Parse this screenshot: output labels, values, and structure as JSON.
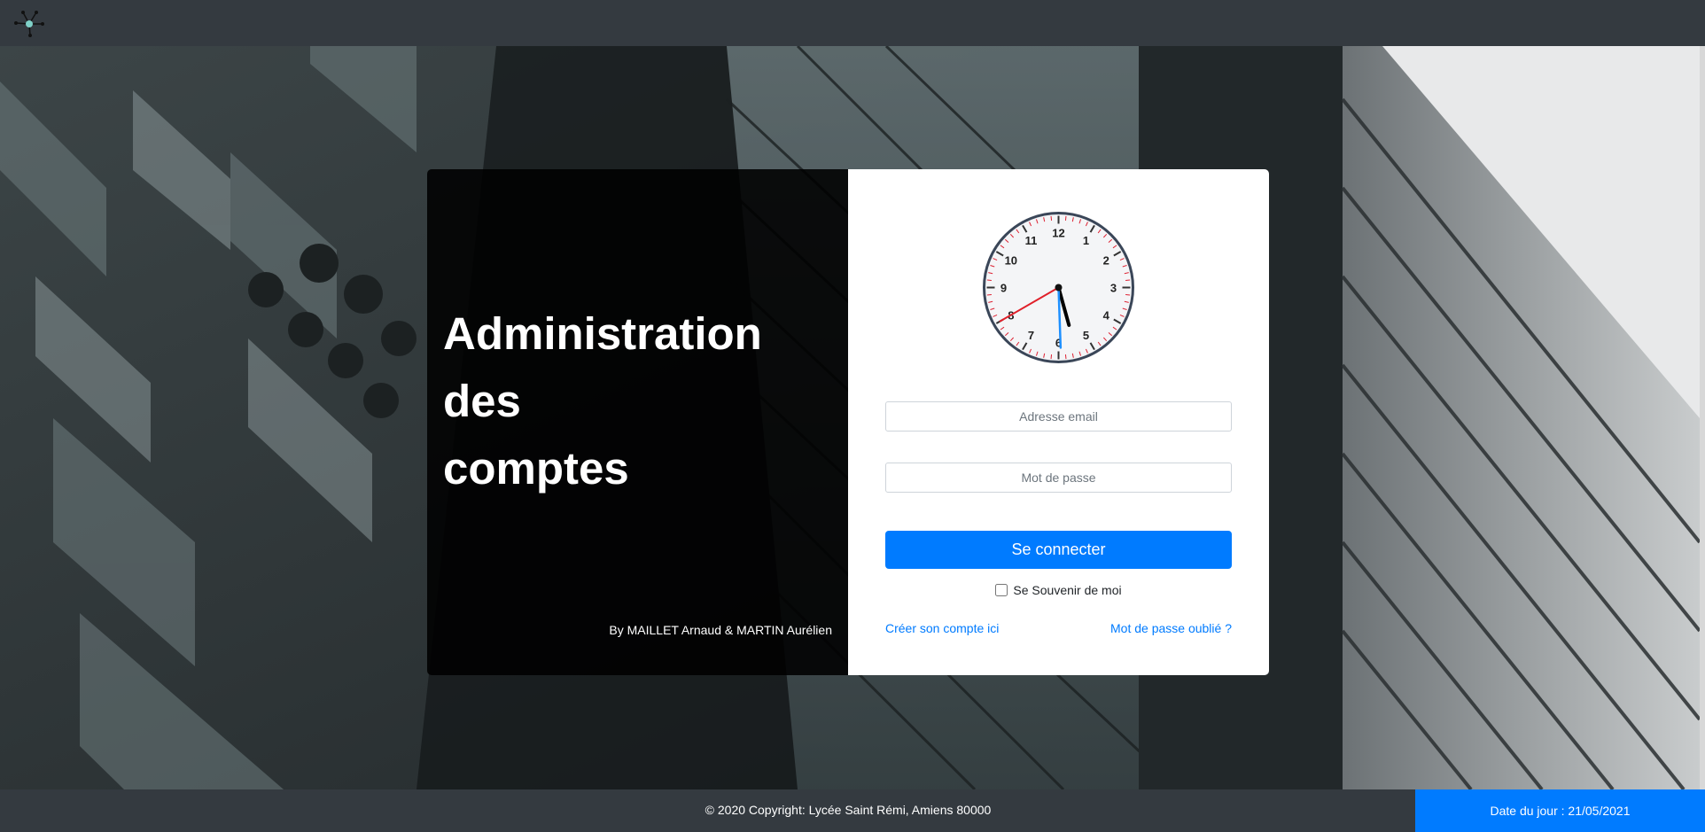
{
  "header": {
    "logo_icon": "network-nodes-icon"
  },
  "hero": {
    "title_lines": [
      "Administration",
      "des",
      "comptes"
    ],
    "credits": "By MAILLET Arnaud & MARTIN Aurélien"
  },
  "clock": {
    "numbers": [
      "12",
      "1",
      "2",
      "3",
      "4",
      "5",
      "6",
      "7",
      "8",
      "9",
      "10",
      "11"
    ],
    "hour": 5,
    "minute": 29,
    "second": 40,
    "colors": {
      "hour": "#000000",
      "minute": "#1e90ff",
      "second": "#e0202a",
      "rim": "#3a4658"
    }
  },
  "login": {
    "email_placeholder": "Adresse email",
    "password_placeholder": "Mot de passe",
    "submit_label": "Se connecter",
    "remember_label": "Se Souvenir de moi",
    "create_account_link": "Créer son compte ici",
    "forgot_password_link": "Mot de passe oublié ?"
  },
  "footer": {
    "copyright": "© 2020 Copyright: Lycée Saint Rémi, Amiens 80000",
    "date_label": "Date du jour : 21/05/2021"
  },
  "colors": {
    "accent": "#007bff",
    "topbar": "#343a40"
  }
}
